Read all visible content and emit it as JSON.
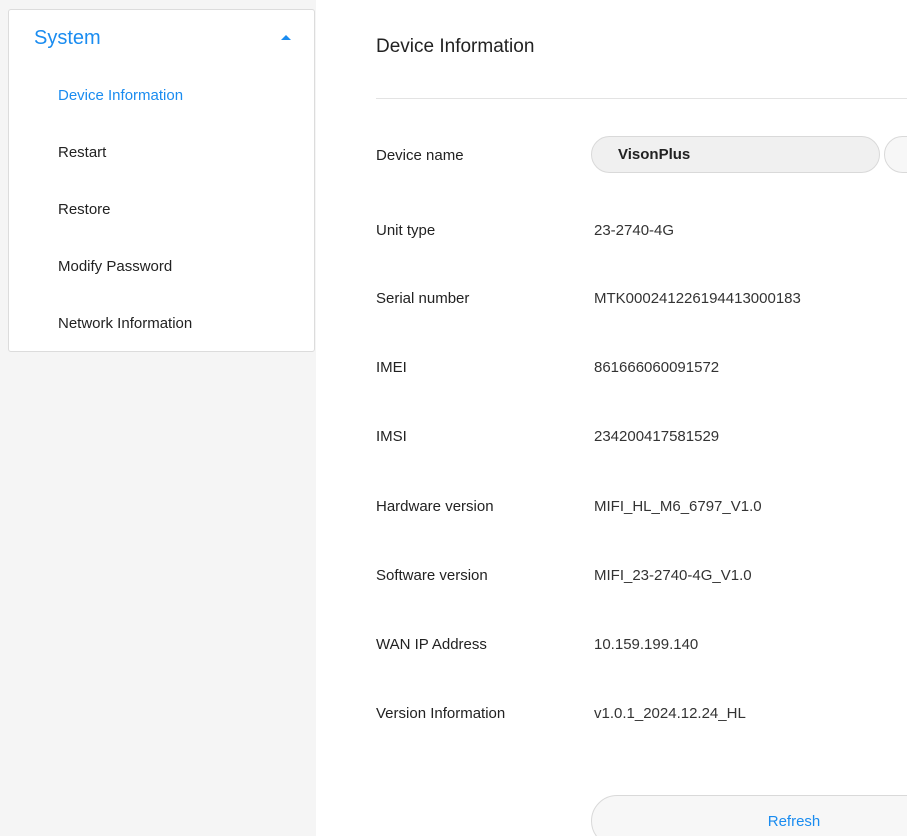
{
  "sidebar": {
    "section_title": "System",
    "items": [
      {
        "label": "Device Information",
        "active": true
      },
      {
        "label": "Restart"
      },
      {
        "label": "Restore"
      },
      {
        "label": "Modify Password"
      },
      {
        "label": "Network Information"
      }
    ]
  },
  "main": {
    "title": "Device Information",
    "device_name": {
      "label": "Device name",
      "value": "VisonPlus"
    },
    "rows": [
      {
        "label": "Unit type",
        "value": "23-2740-4G"
      },
      {
        "label": "Serial number",
        "value": "MTK000241226194413000183"
      },
      {
        "label": "IMEI",
        "value": "861666060091572"
      },
      {
        "label": "IMSI",
        "value": "234200417581529"
      },
      {
        "label": "Hardware version",
        "value": "MIFI_HL_M6_6797_V1.0"
      },
      {
        "label": "Software version",
        "value": "MIFI_23-2740-4G_V1.0"
      },
      {
        "label": "WAN IP Address",
        "value": "10.159.199.140"
      },
      {
        "label": "Version Information",
        "value": "v1.0.1_2024.12.24_HL"
      }
    ],
    "refresh_label": "Refresh"
  },
  "colors": {
    "accent": "#1a8cf0",
    "text": "#222222",
    "background": "#f5f5f5"
  }
}
